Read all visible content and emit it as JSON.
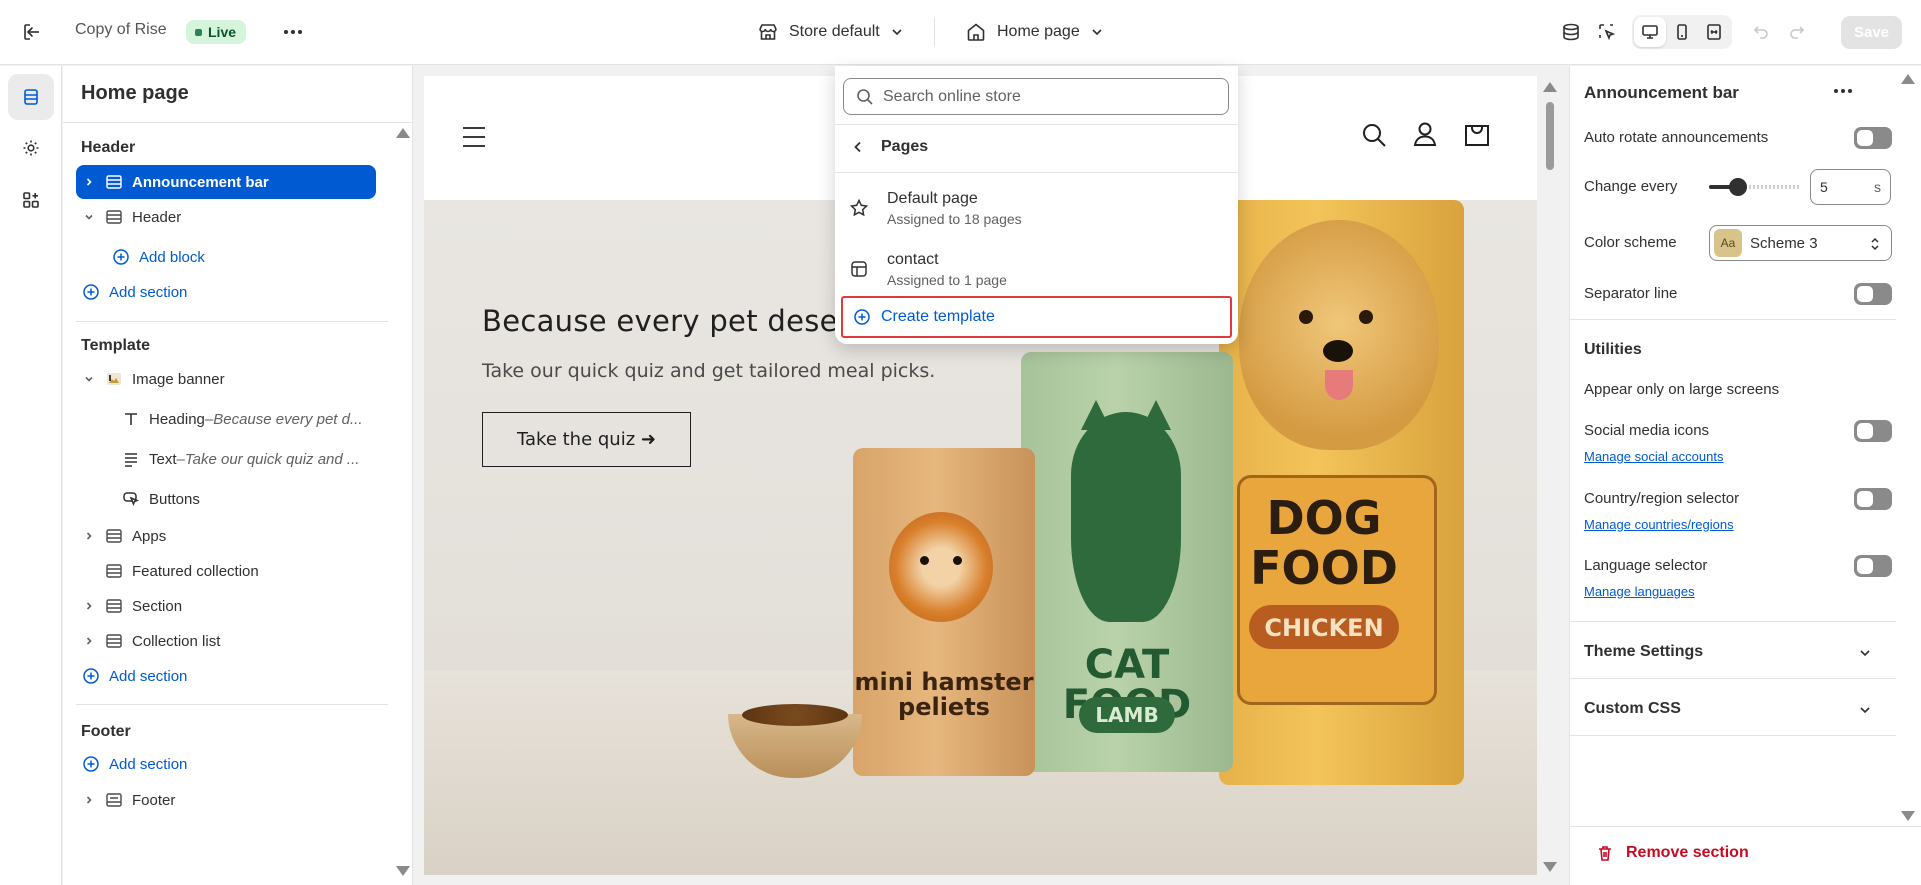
{
  "topbar": {
    "app_title": "Copy of Rise",
    "status_badge": "Live",
    "store_selector": "Store default",
    "page_selector": "Home page",
    "save_label": "Save"
  },
  "left_panel": {
    "title": "Home page",
    "header_group": "Header",
    "announcement_bar": "Announcement bar",
    "header_item": "Header",
    "add_block": "Add block",
    "add_section_header": "Add section",
    "template_group": "Template",
    "image_banner": "Image banner",
    "heading_label": "Heading",
    "heading_sep": " – ",
    "heading_preview": "Because every pet d...",
    "text_label": "Text",
    "text_sep": " – ",
    "text_preview": "Take our quick quiz and ...",
    "buttons": "Buttons",
    "apps": "Apps",
    "featured_collection": "Featured collection",
    "section": "Section",
    "collection_list": "Collection list",
    "add_section_template": "Add section",
    "footer_group": "Footer",
    "add_section_footer": "Add section",
    "footer_item": "Footer"
  },
  "preview": {
    "hero_heading": "Because every pet deserves",
    "hero_subtext": "Take our quick quiz and get tailored meal picks.",
    "hero_button": "Take the quiz ➜",
    "hamster_bag": "mini hamster peliets",
    "cat_bag_title": "CAT FOOD",
    "cat_bag_flavor": "LAMB",
    "dog_bag_title_1": "DOG",
    "dog_bag_title_2": "FOOD",
    "dog_bag_flavor": "CHICKEN"
  },
  "dropdown": {
    "search_placeholder": "Search online store",
    "back_label": "Pages",
    "items": [
      {
        "title": "Default page",
        "subtitle": "Assigned to 18 pages"
      },
      {
        "title": "contact",
        "subtitle": "Assigned to 1 page"
      }
    ],
    "create_template": "Create template"
  },
  "right_panel": {
    "title": "Announcement bar",
    "auto_rotate": "Auto rotate announcements",
    "change_every": "Change every",
    "change_every_value": "5",
    "change_every_unit": "s",
    "color_scheme": "Color scheme",
    "color_scheme_swatch": "Aa",
    "color_scheme_value": "Scheme 3",
    "separator_line": "Separator line",
    "utilities": "Utilities",
    "appear_large": "Appear only on large screens",
    "social_media": "Social media icons",
    "manage_social": "Manage social accounts",
    "country_selector": "Country/region selector",
    "manage_countries": "Manage countries/regions",
    "language_selector": "Language selector",
    "manage_languages": "Manage languages",
    "theme_settings": "Theme Settings",
    "custom_css": "Custom CSS",
    "remove_section": "Remove section"
  },
  "colors": {
    "accent": "#005bd3",
    "live_bg": "#d4f5d9",
    "highlight_border": "#e03a3e",
    "danger": "#c70a24"
  }
}
